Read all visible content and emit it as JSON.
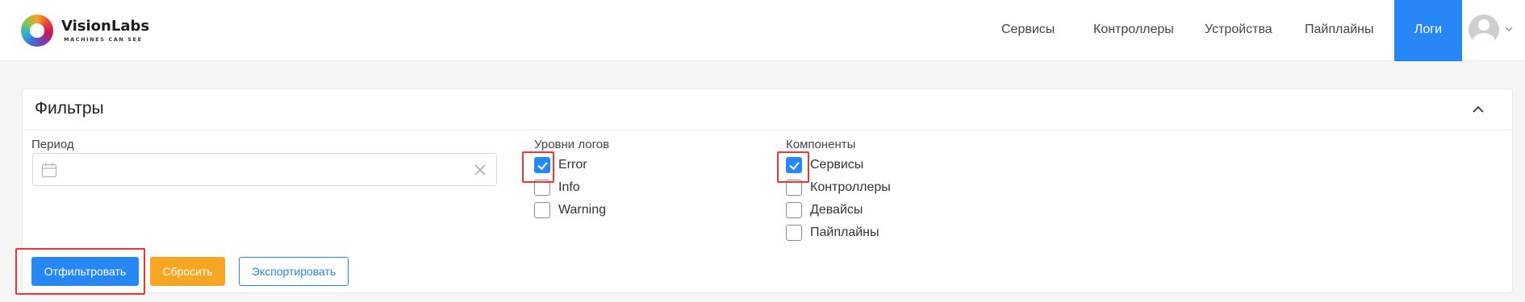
{
  "brand": {
    "name": "VisionLabs",
    "tagline": "MACHINES CAN SEE"
  },
  "nav": {
    "items": [
      "Сервисы",
      "Контроллеры",
      "Устройства",
      "Пайплайны"
    ],
    "active": "Логи"
  },
  "filters": {
    "title": "Фильтры",
    "period": {
      "label": "Период",
      "value": ""
    },
    "log_levels": {
      "label": "Уровни логов",
      "options": [
        {
          "label": "Error",
          "checked": true
        },
        {
          "label": "Info",
          "checked": false
        },
        {
          "label": "Warning",
          "checked": false
        }
      ]
    },
    "components": {
      "label": "Компоненты",
      "options": [
        {
          "label": "Сервисы",
          "checked": true
        },
        {
          "label": "Контроллеры",
          "checked": false
        },
        {
          "label": "Девайсы",
          "checked": false
        },
        {
          "label": "Пайплайны",
          "checked": false
        }
      ]
    },
    "buttons": {
      "filter": "Отфильтровать",
      "reset": "Сбросить",
      "export": "Экспортировать"
    }
  },
  "colors": {
    "accent": "#2787f5",
    "warning": "#f6a623",
    "highlight": "#e53935"
  },
  "icons": [
    "logo-ring",
    "avatar-icon",
    "chevron-down-icon",
    "chevron-up-icon",
    "calendar-icon",
    "clear-icon",
    "check-icon"
  ]
}
